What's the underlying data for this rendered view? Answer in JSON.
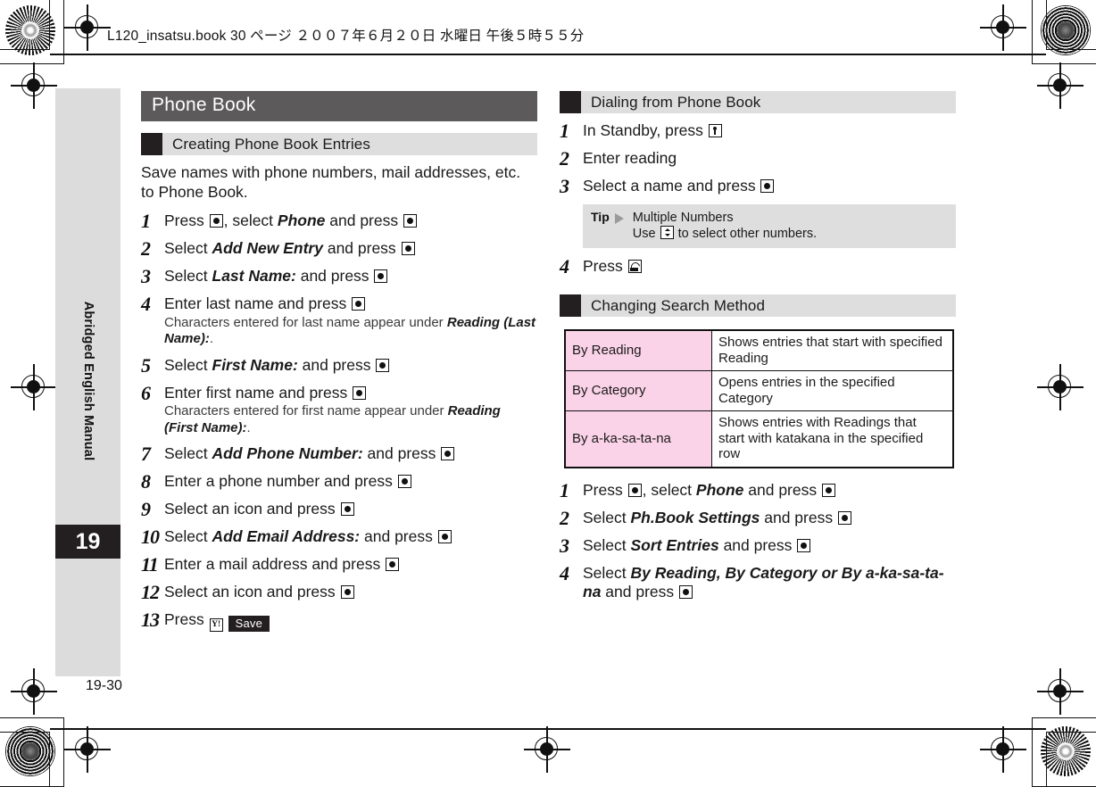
{
  "page_header": "L120_insatsu.book  30 ページ  ２００７年６月２０日   水曜日   午後５時５５分",
  "sidebar": {
    "vertical_label": "Abridged English Manual",
    "chapter_number": "19",
    "folio": "19-30"
  },
  "left_column": {
    "chapter_title": "Phone Book",
    "section": {
      "heading": "Creating Phone Book Entries",
      "intro": "Save names with phone numbers, mail addresses, etc. to Phone Book.",
      "steps": [
        {
          "num": "1",
          "text_before": "Press ",
          "icon1": "center-select-key",
          "text_mid": ", select ",
          "italic": "Phone",
          "text_after": " and press ",
          "icon2": "center-select-key"
        },
        {
          "num": "2",
          "text_before": "Select ",
          "italic": "Add New Entry",
          "text_after": " and press ",
          "icon2": "center-select-key"
        },
        {
          "num": "3",
          "text_before": "Select ",
          "italic": "Last Name:",
          "text_after": " and press ",
          "icon2": "center-select-key"
        },
        {
          "num": "4",
          "text_before": "Enter last name and press ",
          "icon2": "center-select-key",
          "note_before": "Characters entered for last name appear under ",
          "note_italic": "Reading (Last Name):",
          "note_after": "."
        },
        {
          "num": "5",
          "text_before": "Select ",
          "italic": "First Name:",
          "text_after": " and press ",
          "icon2": "center-select-key"
        },
        {
          "num": "6",
          "text_before": "Enter first name and press ",
          "icon2": "center-select-key",
          "note_before": "Characters entered for first name appear under ",
          "note_italic": "Reading (First Name):",
          "note_after": "."
        },
        {
          "num": "7",
          "text_before": "Select ",
          "italic": "Add Phone Number:",
          "text_after": " and press ",
          "icon2": "center-select-key"
        },
        {
          "num": "8",
          "text_before": "Enter a phone number and press ",
          "icon2": "center-select-key"
        },
        {
          "num": "9",
          "text_before": "Select an icon and press ",
          "icon2": "center-select-key"
        },
        {
          "num": "10",
          "text_before": "Select ",
          "italic": "Add Email Address:",
          "text_after": " and press ",
          "icon2": "center-select-key"
        },
        {
          "num": "11",
          "text_before": "Enter a mail address and press ",
          "icon2": "center-select-key"
        },
        {
          "num": "12",
          "text_before": "Select an icon and press ",
          "icon2": "center-select-key"
        },
        {
          "num": "13",
          "text_before": "Press ",
          "icon2": "yahoo-key",
          "softkey": "Save"
        }
      ]
    }
  },
  "right_column": {
    "section_dialing": {
      "heading": "Dialing from Phone Book",
      "steps": [
        {
          "num": "1",
          "text_before": "In Standby, press ",
          "icon2": "nav-down-key"
        },
        {
          "num": "2",
          "text_before": "Enter reading"
        },
        {
          "num": "3",
          "text_before": "Select a name and press ",
          "icon2": "center-select-key"
        },
        {
          "num": "4",
          "text_before": "Press ",
          "icon2": "send-call-key"
        }
      ],
      "tip": {
        "label": "Tip",
        "title": "Multiple Numbers",
        "body_before": "Use ",
        "body_icon": "nav-updown-key",
        "body_after": " to select other numbers."
      }
    },
    "section_search": {
      "heading": "Changing Search Method",
      "table": {
        "rows": [
          {
            "key": "By Reading",
            "value": "Shows entries that start with specified Reading"
          },
          {
            "key": "By Category",
            "value": "Opens entries in the specified Category"
          },
          {
            "key": "By a-ka-sa-ta-na",
            "value": "Shows entries with Readings that start with katakana in the specified row"
          }
        ]
      },
      "steps": [
        {
          "num": "1",
          "text_before": "Press ",
          "icon1": "center-select-key",
          "text_mid": ", select ",
          "italic": "Phone",
          "text_after": " and press ",
          "icon2": "center-select-key"
        },
        {
          "num": "2",
          "text_before": "Select ",
          "italic": "Ph.Book Settings",
          "text_after": " and press ",
          "icon2": "center-select-key"
        },
        {
          "num": "3",
          "text_before": "Select ",
          "italic": "Sort Entries",
          "text_after": " and press ",
          "icon2": "center-select-key"
        },
        {
          "num": "4",
          "text_before": "Select ",
          "italic_multi": "By Reading, By Category or By a-ka-sa-ta-na",
          "text_after": " and press ",
          "icon2": "center-select-key"
        }
      ]
    }
  },
  "colors": {
    "title_bar": "#5c5a5a",
    "section_band": "#dedede",
    "section_block": "#231f20",
    "sidebar": "#dcdcdc",
    "table_key": "#fbd3e8",
    "text": "#1a1a1a"
  }
}
